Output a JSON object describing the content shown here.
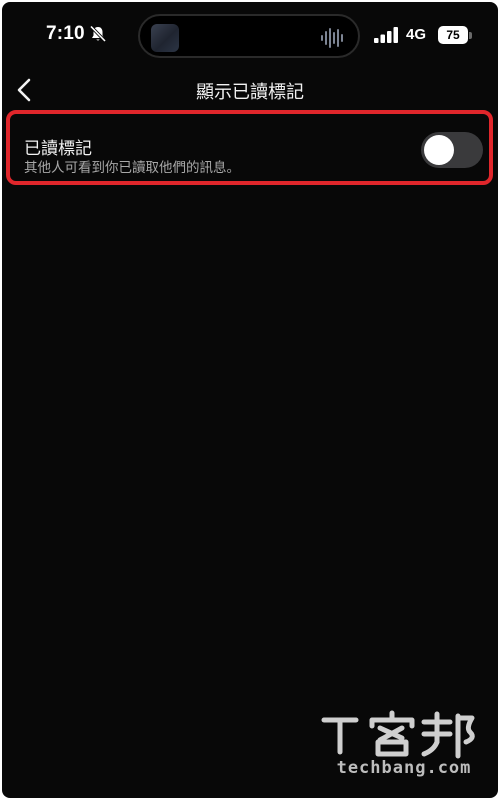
{
  "status_bar": {
    "time": "7:10",
    "network": "4G",
    "battery": "75",
    "icons": [
      "bell-muted-icon",
      "waveform-icon",
      "signal-bars-icon"
    ]
  },
  "header": {
    "title": "顯示已讀標記",
    "back_icon": "chevron-left-icon"
  },
  "setting": {
    "title": "已讀標記",
    "description": "其他人可看到你已讀取他們的訊息。",
    "toggle_on": false
  },
  "watermark": {
    "logo_text": "T客邦",
    "url": "techbang.com"
  },
  "colors": {
    "background": "#080808",
    "highlight_border": "#e0262b",
    "toggle_off": "#3a3a3c"
  }
}
